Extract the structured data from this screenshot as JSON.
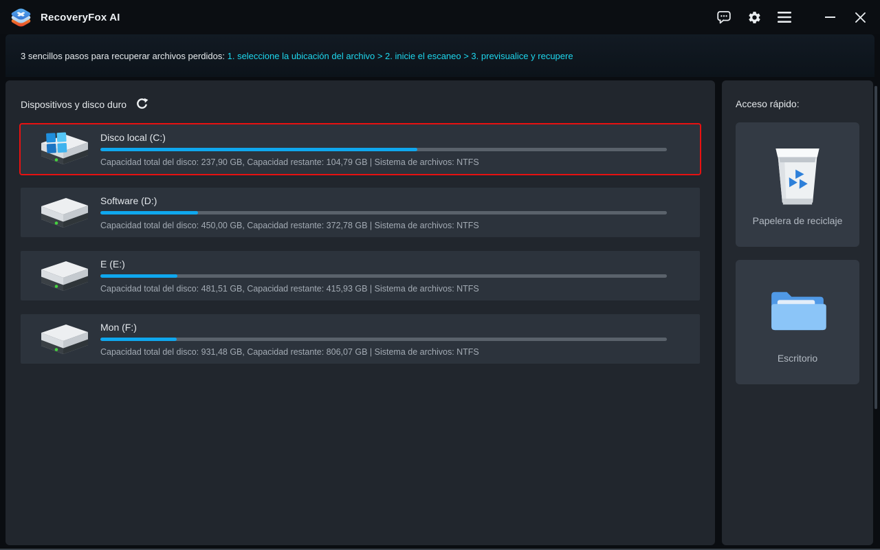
{
  "window": {
    "title": "RecoveryFox AI"
  },
  "titlebar": {
    "icons": [
      {
        "name": "message-feedback-icon"
      },
      {
        "name": "settings-gear-icon"
      },
      {
        "name": "hamburger-menu-icon"
      }
    ],
    "window_controls": [
      {
        "name": "minimize-button"
      },
      {
        "name": "close-button"
      }
    ]
  },
  "steps": {
    "prefix": "3 sencillos pasos para recuperar archivos perdidos: ",
    "highlight": "1. seleccione la ubicación del archivo > 2. inicie el escaneo > 3. previsualice y recupere"
  },
  "main": {
    "section_title": "Dispositivos y disco duro",
    "refresh_icon": "refresh-icon",
    "drives": [
      {
        "name": "Disco local (C:)",
        "details": "Capacidad total del disco: 237,90 GB, Capacidad restante: 104,79 GB | Sistema de archivos: NTFS",
        "used_percent": 56,
        "selected": true,
        "system": true
      },
      {
        "name": "Software (D:)",
        "details": "Capacidad total del disco: 450,00 GB, Capacidad restante: 372,78 GB | Sistema de archivos: NTFS",
        "used_percent": 17.2,
        "selected": false,
        "system": false
      },
      {
        "name": "E (E:)",
        "details": "Capacidad total del disco: 481,51 GB, Capacidad restante: 415,93 GB | Sistema de archivos: NTFS",
        "used_percent": 13.6,
        "selected": false,
        "system": false
      },
      {
        "name": "Mon (F:)",
        "details": "Capacidad total del disco: 931,48 GB, Capacidad restante: 806,07 GB | Sistema de archivos: NTFS",
        "used_percent": 13.5,
        "selected": false,
        "system": false
      }
    ]
  },
  "sidebar": {
    "title": "Acceso rápido:",
    "items": [
      {
        "label": "Papelera de reciclaje",
        "icon": "recycle-bin-icon"
      },
      {
        "label": "Escritorio",
        "icon": "desktop-folder-icon"
      }
    ]
  },
  "colors": {
    "accent_blue": "#0fa7ee",
    "accent_cyan": "#1ed7ee",
    "selection_red": "#e81111",
    "bar_track": "#5a626b"
  }
}
